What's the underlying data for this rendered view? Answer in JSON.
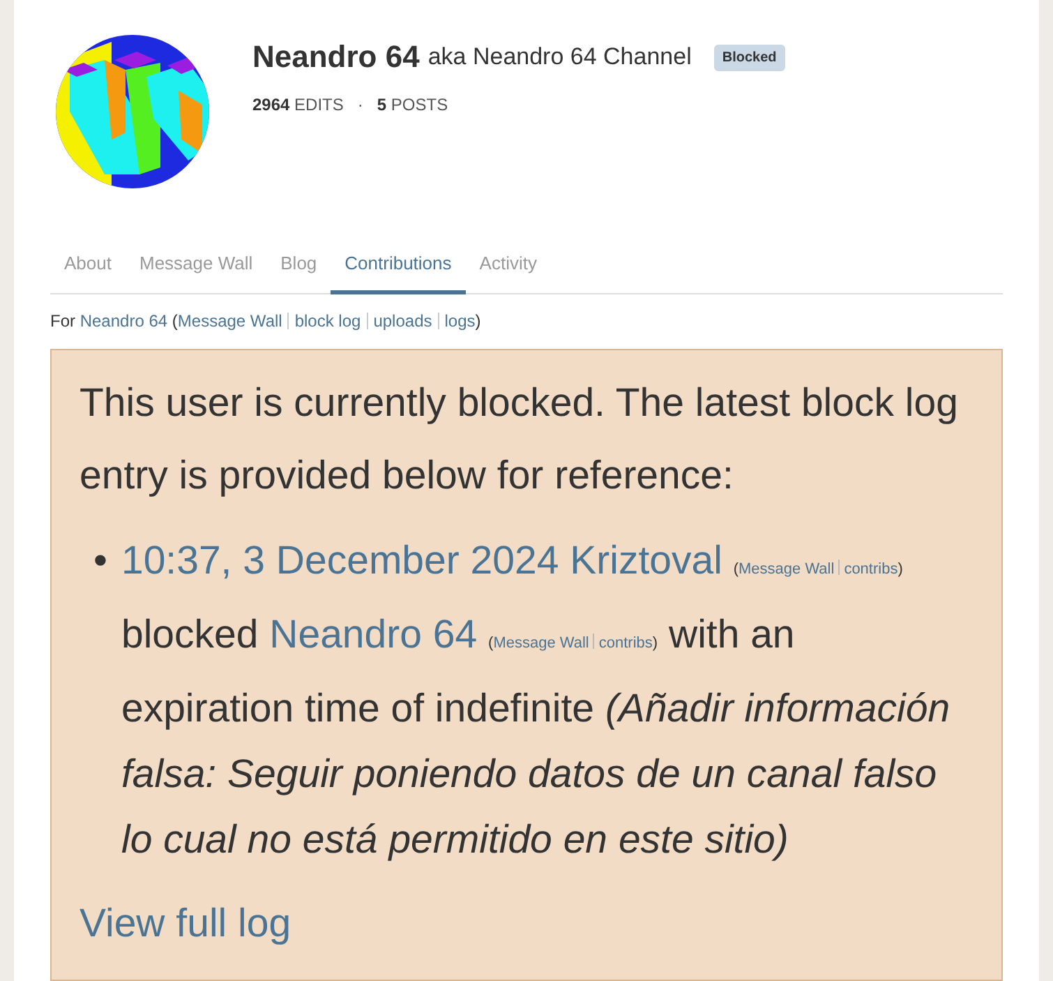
{
  "profile": {
    "name": "Neandro 64",
    "aka": "aka Neandro 64 Channel",
    "badge": "Blocked",
    "stats": [
      {
        "count": "2964",
        "label": "EDITS"
      },
      {
        "count": "5",
        "label": "POSTS"
      }
    ],
    "stat_separator": "·"
  },
  "tabs": [
    {
      "label": "About",
      "selected": false
    },
    {
      "label": "Message Wall",
      "selected": false
    },
    {
      "label": "Blog",
      "selected": false
    },
    {
      "label": "Contributions",
      "selected": true
    },
    {
      "label": "Activity",
      "selected": false
    }
  ],
  "subtitle": [
    {
      "kind": "text",
      "text": "For "
    },
    {
      "kind": "link",
      "text": "Neandro 64"
    },
    {
      "kind": "text",
      "text": " ("
    },
    {
      "kind": "link",
      "text": "Message Wall"
    },
    {
      "kind": "sep"
    },
    {
      "kind": "link",
      "text": "block log"
    },
    {
      "kind": "sep"
    },
    {
      "kind": "link",
      "text": "uploads"
    },
    {
      "kind": "sep"
    },
    {
      "kind": "link",
      "text": "logs"
    },
    {
      "kind": "text",
      "text": ")"
    }
  ],
  "notice": {
    "message": "This user is currently blocked. The latest block log entry is provided below for reference:",
    "bullet": "•",
    "entry": [
      {
        "kind": "link",
        "text": "10:37, 3 December 2024"
      },
      {
        "kind": "space"
      },
      {
        "kind": "link",
        "text": "Kriztoval"
      },
      {
        "kind": "space"
      },
      {
        "kind": "small",
        "text": "("
      },
      {
        "kind": "small-link",
        "text": "Message Wall"
      },
      {
        "kind": "sep"
      },
      {
        "kind": "small-link",
        "text": "contribs"
      },
      {
        "kind": "small",
        "text": ")"
      },
      {
        "kind": "text",
        "text": " blocked "
      },
      {
        "kind": "link",
        "text": "Neandro 64"
      },
      {
        "kind": "space"
      },
      {
        "kind": "small",
        "text": "("
      },
      {
        "kind": "small-link",
        "text": "Message Wall"
      },
      {
        "kind": "sep"
      },
      {
        "kind": "small-link",
        "text": "contribs"
      },
      {
        "kind": "small",
        "text": ")"
      },
      {
        "kind": "text",
        "text": " with an expiration time of indefinite "
      },
      {
        "kind": "italic",
        "text": "(Añadir información falsa: Seguir poniendo datos de un canal falso lo cual no está permitido en este sitio)"
      }
    ],
    "link": "View full log"
  }
}
